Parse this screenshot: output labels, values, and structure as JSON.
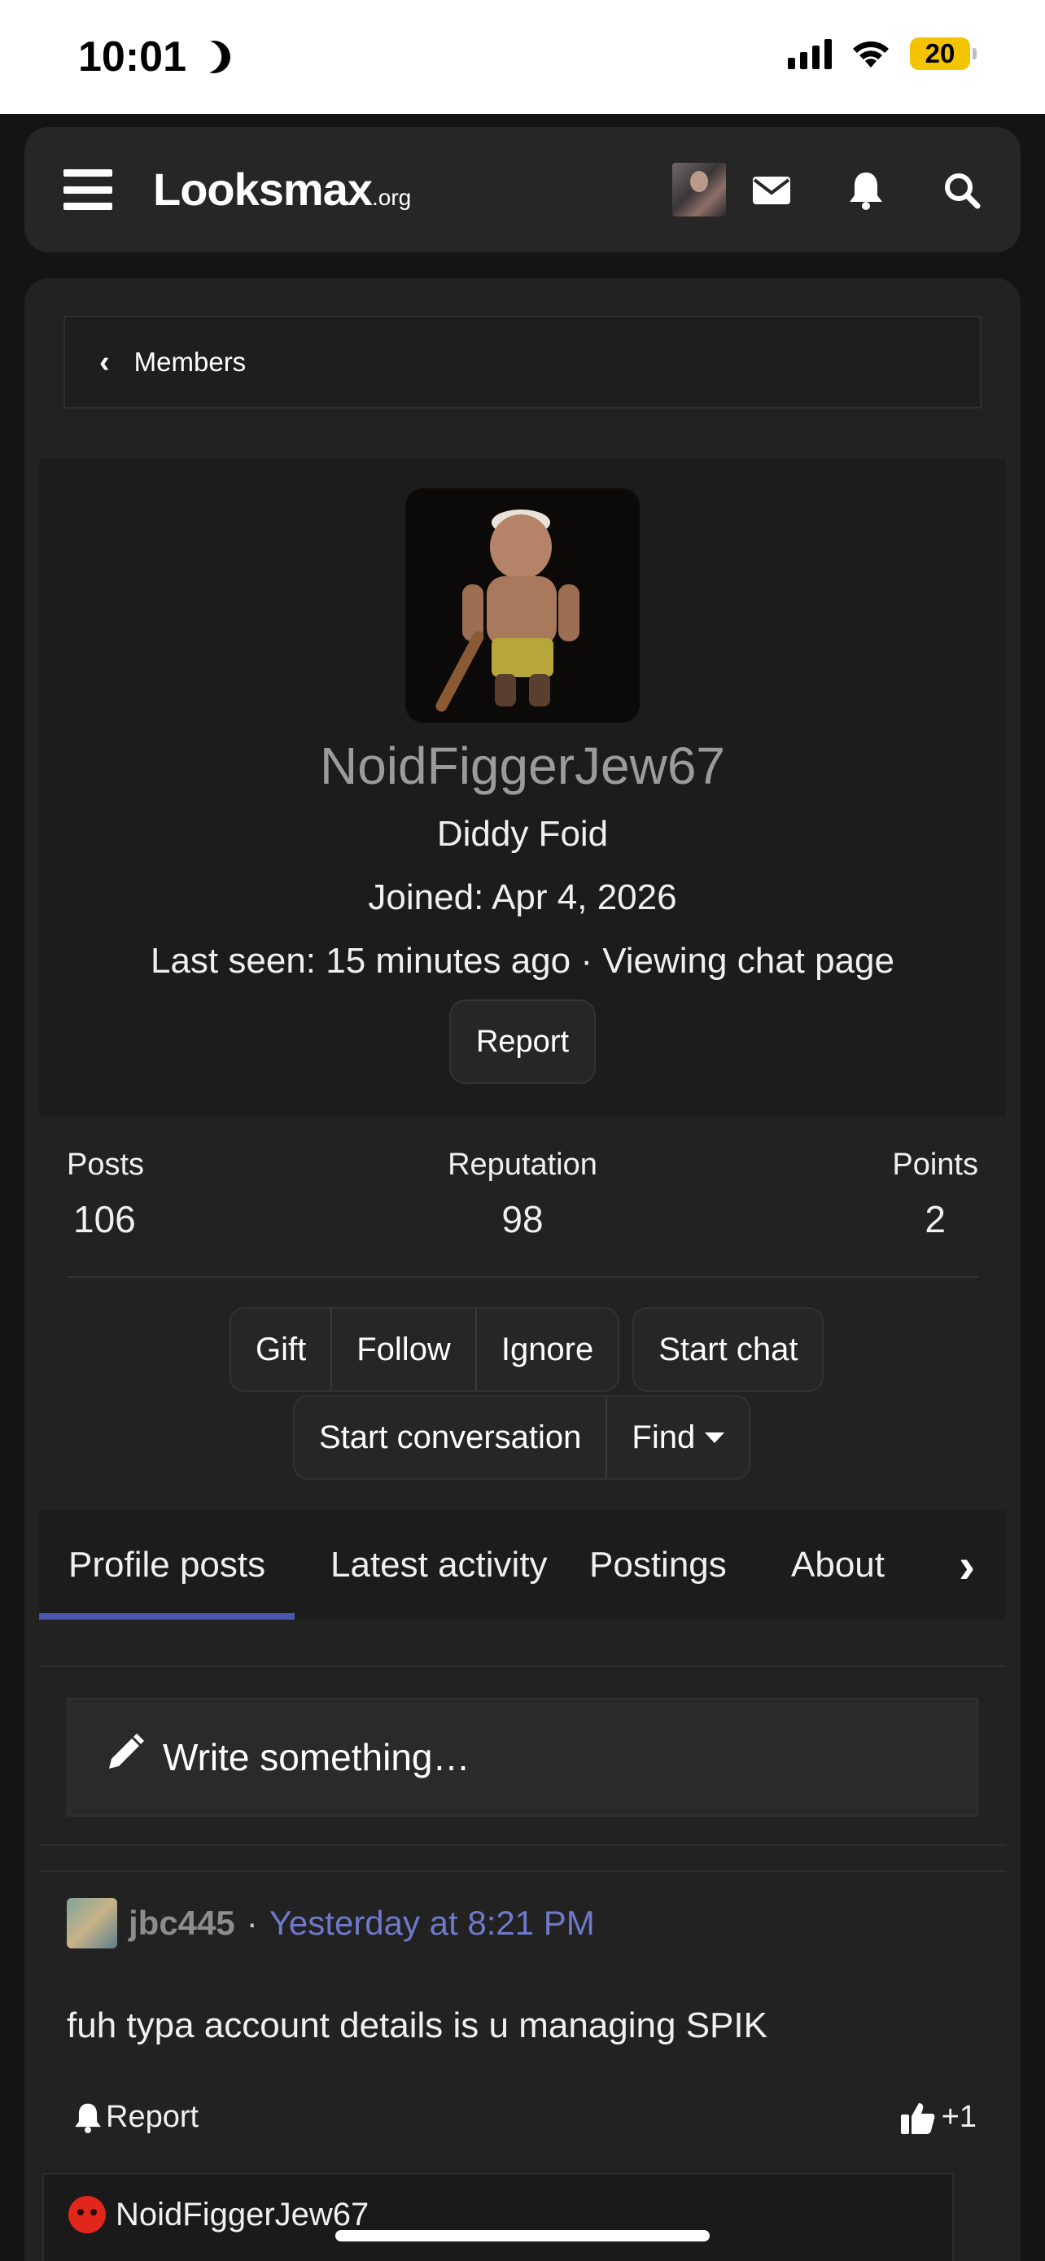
{
  "status_bar": {
    "time": "10:01",
    "battery_level": "20",
    "battery_color": "#f5c400"
  },
  "header": {
    "logo_main": "Looksmax",
    "logo_tld": ".org",
    "icons": [
      "menu-icon",
      "avatar",
      "mail-icon",
      "bell-icon",
      "search-icon"
    ]
  },
  "breadcrumb": {
    "label": "Members"
  },
  "profile": {
    "username": "NoidFiggerJew67",
    "user_title": "Diddy Foid",
    "joined": "Joined: Apr 4, 2026",
    "last_seen": "Last seen: 15 minutes ago · Viewing chat page",
    "report_label": "Report",
    "username_color": "#9b9b9b"
  },
  "stats": [
    {
      "label": "Posts",
      "value": "106"
    },
    {
      "label": "Reputation",
      "value": "98"
    },
    {
      "label": "Points",
      "value": "2"
    }
  ],
  "actions": {
    "gift": "Gift",
    "follow": "Follow",
    "ignore": "Ignore",
    "start_chat": "Start chat",
    "start_conversation": "Start conversation",
    "find": "Find"
  },
  "tabs": [
    {
      "label": "Profile posts",
      "active": true
    },
    {
      "label": "Latest activity",
      "active": false
    },
    {
      "label": "Postings",
      "active": false
    },
    {
      "label": "About",
      "active": false
    }
  ],
  "tab_accent": "#4a57b0",
  "compose": {
    "placeholder": "Write something…"
  },
  "post": {
    "author": "jbc445",
    "separator": "·",
    "time": "Yesterday at 8:21 PM",
    "body": "fuh typa account details is u managing SPIK",
    "report_label": "Report",
    "reaction_count": "+1",
    "time_color": "#6e79c9"
  },
  "reply": {
    "author": "NoidFiggerJew67"
  }
}
